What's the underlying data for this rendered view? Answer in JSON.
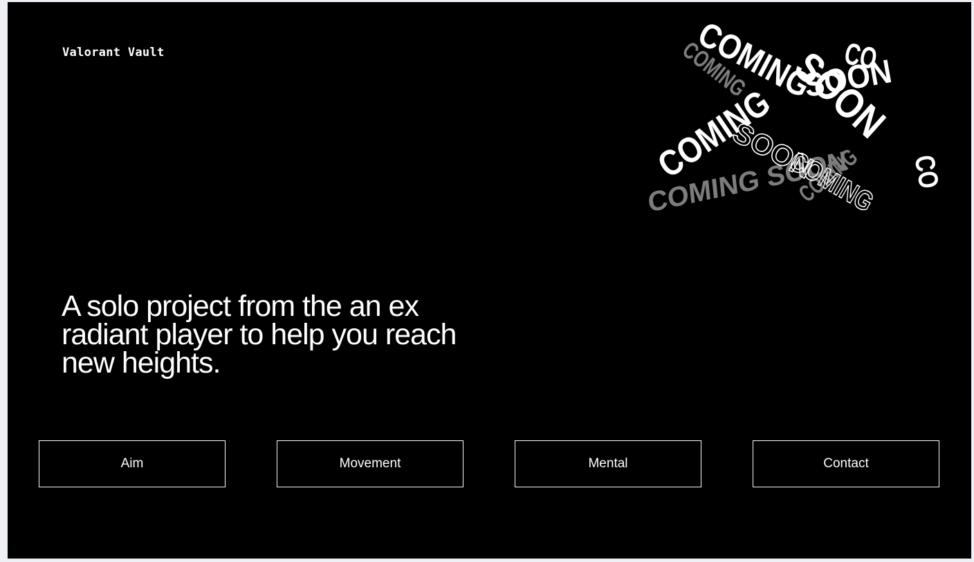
{
  "brand": {
    "title": "Valorant Vault"
  },
  "hero": {
    "headline": "A solo project from the an ex radiant player to help you reach new heights."
  },
  "badge": {
    "text_main": "COMING SOON",
    "text_left": "COMING",
    "text_right": "SOON",
    "text_tail": "CO",
    "text_ghost": "COMING SOON",
    "text_outline": "COMING",
    "text_outline_2": "SOON"
  },
  "nav": {
    "aim": "Aim",
    "movement": "Movement",
    "mental": "Mental",
    "contact": "Contact"
  },
  "colors": {
    "background": "#000000",
    "foreground": "#ffffff",
    "ghost_text": "#8a8a8a",
    "page_margin": "#eef0f6"
  }
}
